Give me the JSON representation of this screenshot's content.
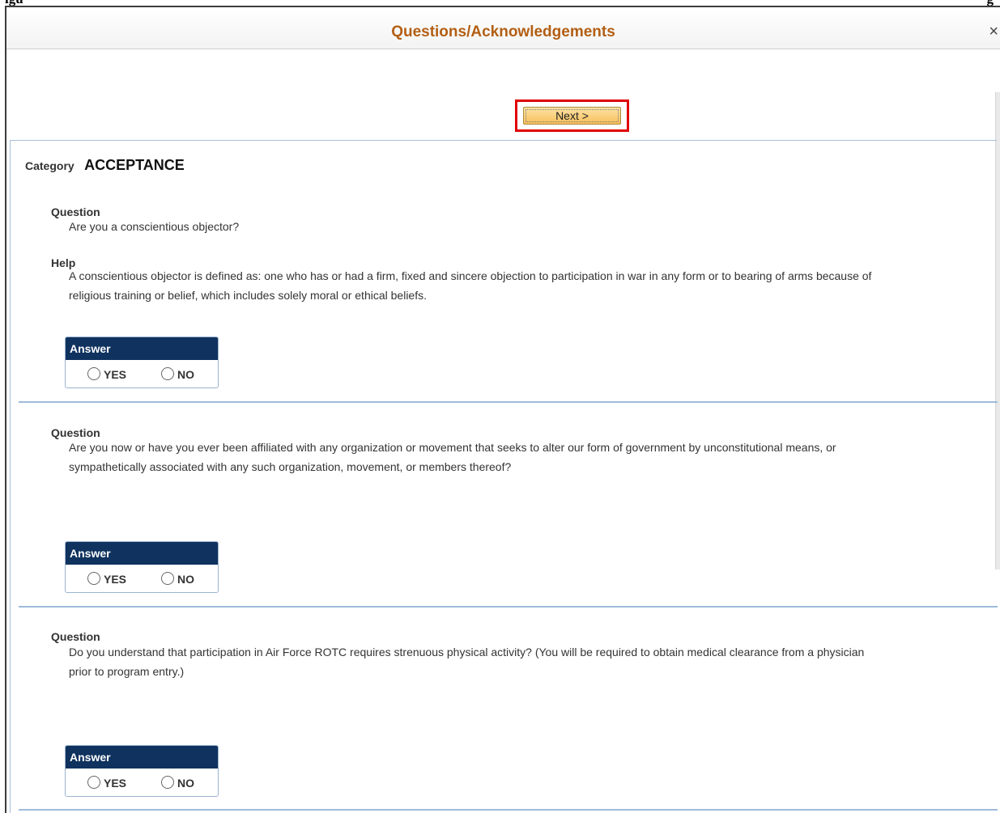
{
  "page_top_fragment": {
    "left": "igu",
    "right": "g"
  },
  "modal": {
    "title": "Questions/Acknowledgements",
    "close_glyph": "×",
    "next_label": "Next >"
  },
  "category": {
    "label": "Category",
    "value": "ACCEPTANCE"
  },
  "questions": [
    {
      "question_label": "Question",
      "text_lines": [
        "Are you a conscientious objector?"
      ],
      "help_label": "Help",
      "help_lines": [
        "A conscientious objector is defined as:  one who has or had a firm, fixed and sincere objection to participation in war in any form or to bearing of arms because of",
        "religious training or belief, which includes solely moral or ethical beliefs."
      ],
      "answer": {
        "header": "Answer",
        "yes": "YES",
        "no": "NO"
      }
    },
    {
      "question_label": "Question",
      "text_lines": [
        "Are you now or have you ever been affiliated with any organization or movement that seeks to alter our form of government by unconstitutional means, or",
        "sympathetically associated with any such organization, movement, or members thereof?"
      ],
      "answer": {
        "header": "Answer",
        "yes": "YES",
        "no": "NO"
      }
    },
    {
      "question_label": "Question",
      "text_lines": [
        "Do you understand that participation in Air Force ROTC requires strenuous physical activity? (You will be required to obtain medical clearance from a physician",
        "prior to program entry.)"
      ],
      "answer": {
        "header": "Answer",
        "yes": "YES",
        "no": "NO"
      }
    }
  ],
  "icons": {
    "close": "close-icon",
    "radio": "radio-button"
  },
  "colors": {
    "title": "#b35f14",
    "answer_header_bg": "#0f325e",
    "highlight_border": "#e00000",
    "next_button": "#f7bf5a",
    "divider": "#9fbbdb"
  }
}
